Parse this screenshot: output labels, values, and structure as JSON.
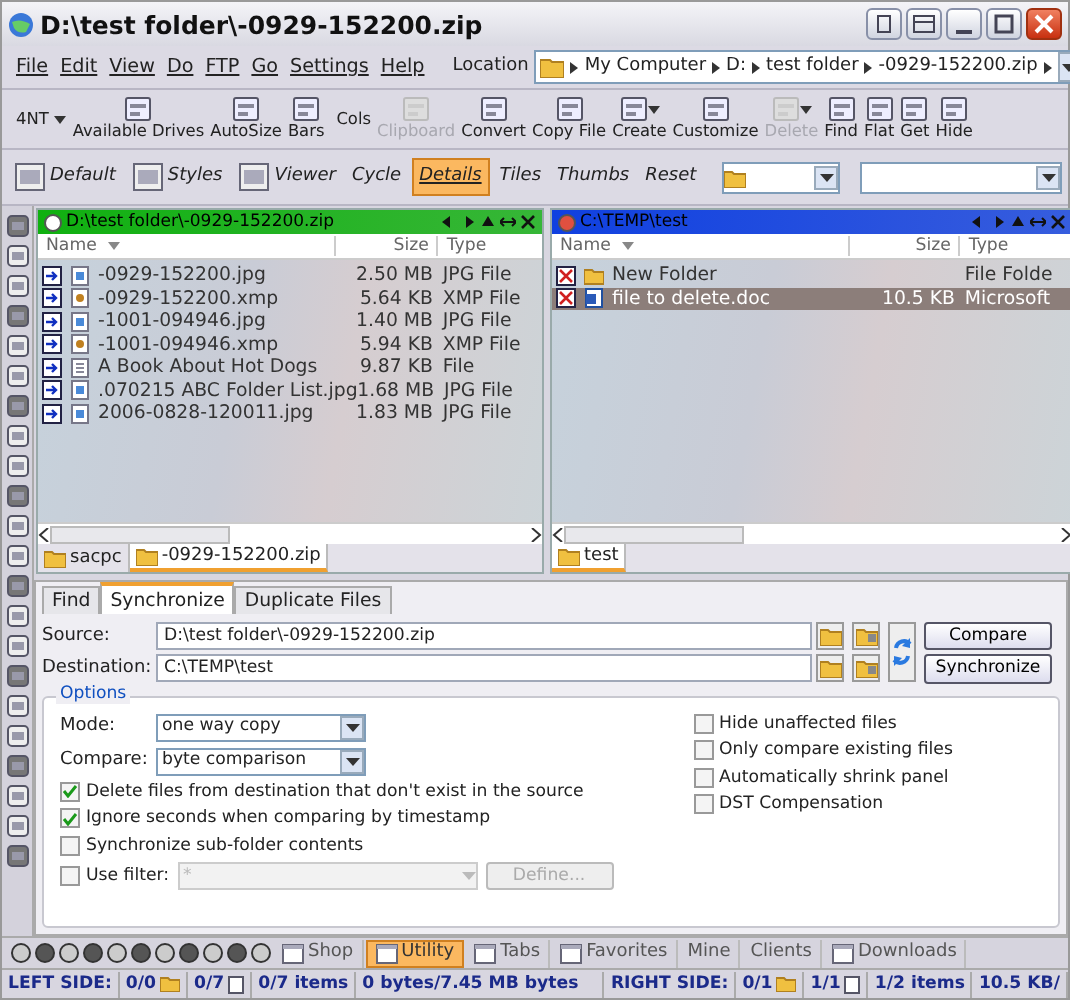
{
  "window": {
    "title": "D:\\test folder\\-0929-152200.zip"
  },
  "menu": [
    "File",
    "Edit",
    "View",
    "Do",
    "FTP",
    "Go",
    "Settings",
    "Help"
  ],
  "location": {
    "label": "Location",
    "crumbs": [
      "My Computer",
      "D:",
      "test folder",
      "-0929-152200.zip"
    ]
  },
  "toolbar": [
    {
      "label": "4NT",
      "disabled": false,
      "dropdown": true,
      "icon": false
    },
    {
      "label": "Available Drives",
      "disabled": false,
      "dropdown": false,
      "icon": true
    },
    {
      "label": "AutoSize",
      "disabled": false,
      "dropdown": false,
      "icon": true
    },
    {
      "label": "Bars",
      "disabled": false,
      "dropdown": false,
      "icon": true
    },
    {
      "label": "Cols",
      "disabled": false,
      "dropdown": false,
      "icon": false
    },
    {
      "label": "Clipboard",
      "disabled": true,
      "dropdown": false,
      "icon": true
    },
    {
      "label": "Convert",
      "disabled": false,
      "dropdown": false,
      "icon": true
    },
    {
      "label": "Copy File",
      "disabled": false,
      "dropdown": false,
      "icon": true
    },
    {
      "label": "Create",
      "disabled": false,
      "dropdown": true,
      "icon": true
    },
    {
      "label": "Customize",
      "disabled": false,
      "dropdown": false,
      "icon": true
    },
    {
      "label": "Delete",
      "disabled": true,
      "dropdown": true,
      "icon": true
    },
    {
      "label": "Find",
      "disabled": false,
      "dropdown": false,
      "icon": true
    },
    {
      "label": "Flat",
      "disabled": false,
      "dropdown": false,
      "icon": true
    },
    {
      "label": "Get",
      "disabled": false,
      "dropdown": false,
      "icon": true
    },
    {
      "label": "Hide",
      "disabled": false,
      "dropdown": false,
      "icon": true
    }
  ],
  "view_bar": [
    {
      "label": "Default",
      "selected": false,
      "icon": true
    },
    {
      "label": "Styles",
      "selected": false,
      "icon": true
    },
    {
      "label": "Viewer",
      "selected": false,
      "icon": true
    },
    {
      "label": "Cycle",
      "selected": false,
      "icon": false
    },
    {
      "label": "Details",
      "selected": true,
      "icon": false
    },
    {
      "label": "Tiles",
      "selected": false,
      "icon": false
    },
    {
      "label": "Thumbs",
      "selected": false,
      "icon": false
    },
    {
      "label": "Reset",
      "selected": false,
      "icon": false
    }
  ],
  "panes": [
    {
      "path": "D:\\test folder\\-0929-152200.zip",
      "color": "#10b010",
      "kind": "source",
      "columns": [
        "Name",
        "Size",
        "Type"
      ],
      "rows": [
        {
          "name": "-0929-152200.jpg",
          "size": "2.50 MB",
          "type": "JPG File",
          "kind": "image",
          "selected": false
        },
        {
          "name": "-0929-152200.xmp",
          "size": "5.64 KB",
          "type": "XMP File",
          "kind": "data",
          "selected": false
        },
        {
          "name": "-1001-094946.jpg",
          "size": "1.40 MB",
          "type": "JPG File",
          "kind": "image",
          "selected": false
        },
        {
          "name": "-1001-094946.xmp",
          "size": "5.94 KB",
          "type": "XMP File",
          "kind": "data",
          "selected": false
        },
        {
          "name": "A Book About Hot Dogs",
          "size": "9.87 KB",
          "type": "File",
          "kind": "plain",
          "selected": false
        },
        {
          "name": ".070215 ABC Folder List.jpg",
          "size": "1.68 MB",
          "type": "JPG File",
          "kind": "image",
          "selected": false
        },
        {
          "name": "2006-0828-120011.jpg",
          "size": "1.83 MB",
          "type": "JPG File",
          "kind": "image",
          "selected": false
        }
      ],
      "tabs": [
        {
          "label": "sacpc",
          "selected": false
        },
        {
          "label": "-0929-152200.zip",
          "selected": true
        }
      ]
    },
    {
      "path": "C:\\TEMP\\test",
      "color": "#1040e0",
      "kind": "target",
      "columns": [
        "Name",
        "Size",
        "Type"
      ],
      "rows": [
        {
          "name": "New Folder",
          "size": "",
          "type": "File Folde",
          "kind": "folder",
          "selected": false
        },
        {
          "name": "file to delete.doc",
          "size": "10.5 KB",
          "type": "Microsoft",
          "kind": "doc",
          "selected": true
        }
      ],
      "tabs": [
        {
          "label": "test",
          "selected": true
        }
      ]
    }
  ],
  "sync_panel": {
    "tabs": [
      {
        "label": "Find",
        "selected": false
      },
      {
        "label": "Synchronize",
        "selected": true
      },
      {
        "label": "Duplicate Files",
        "selected": false
      }
    ],
    "source": {
      "label": "Source:",
      "value": "D:\\test folder\\-0929-152200.zip"
    },
    "destination": {
      "label": "Destination:",
      "value": "C:\\TEMP\\test"
    },
    "buttons": [
      "Compare",
      "Synchronize"
    ],
    "options_title": "Options",
    "mode": {
      "label": "Mode:",
      "value": "one way copy"
    },
    "compare": {
      "label": "Compare:",
      "value": "byte comparison"
    },
    "left_checks": [
      {
        "label": "Delete files from destination that don't exist in the source",
        "checked": true
      },
      {
        "label": "Ignore seconds when comparing by timestamp",
        "checked": true
      },
      {
        "label": "Synchronize sub-folder contents",
        "checked": false
      }
    ],
    "filter": {
      "label": "Use filter:",
      "checked": false,
      "value": "*",
      "disabled": true,
      "button": "Define..."
    },
    "right_checks": [
      {
        "label": "Hide unaffected files",
        "checked": false
      },
      {
        "label": "Only compare existing files",
        "checked": false
      },
      {
        "label": "Automatically shrink panel",
        "checked": false
      },
      {
        "label": "DST Compensation",
        "checked": false
      }
    ]
  },
  "bottom_bar": [
    {
      "label": "Shop",
      "selected": false
    },
    {
      "label": "Utility",
      "selected": true
    },
    {
      "label": "Tabs",
      "selected": false
    },
    {
      "label": "Favorites",
      "selected": false
    },
    {
      "label": "Mine",
      "selected": false
    },
    {
      "label": "Clients",
      "selected": false
    },
    {
      "label": "Downloads",
      "selected": false
    }
  ],
  "status_bar": {
    "left_label": "LEFT SIDE:",
    "left": [
      "0/0",
      "0/7",
      "0/7 items",
      "0 bytes/7.45 MB bytes"
    ],
    "right_label": "RIGHT SIDE:",
    "right": [
      "0/1",
      "1/1",
      "1/2 items",
      "10.5 KB/"
    ]
  }
}
